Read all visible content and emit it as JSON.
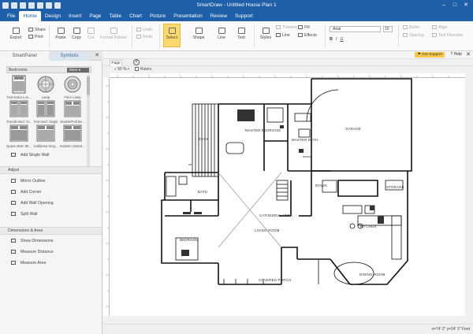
{
  "window": {
    "title": "SmartDraw - Untitled House Plan 1"
  },
  "menu": {
    "items": [
      "File",
      "Home",
      "Design",
      "Insert",
      "Page",
      "Table",
      "Chart",
      "Picture",
      "Presentation",
      "Review",
      "Support"
    ],
    "active": "Home"
  },
  "ribbon": {
    "export": "Export",
    "share": "Share",
    "print": "Print",
    "paste": "Paste",
    "copy": "Copy",
    "cut": "Cut",
    "format_painter": "Format Painter",
    "undo": "Undo",
    "redo": "Redo",
    "select": "Select",
    "shape": "Shape",
    "line": "Line",
    "text": "Text",
    "styles": "Styles",
    "themes": "Themes",
    "fill": "Fill",
    "line_small": "Line",
    "effects": "Effects",
    "font_name": "Arial",
    "font_size": "10",
    "bold": "B",
    "italic": "I",
    "underline": "U",
    "bullet": "Bullet",
    "spacing": "Spacing",
    "align": "Align",
    "text_direction": "Text Direction"
  },
  "left_panel": {
    "tab_smartpanel": "SmartPanel",
    "tab_symbols": "Symbols",
    "library_name": "Bedrooms",
    "more_label": "More",
    "symbols": [
      "Twin Extra Lon...",
      "Lamp",
      "Floor Lamp",
      "Trundle Bed: Si...",
      "Twin Bed: Single",
      "Double/Full Be...",
      "Queen Bed: 80...",
      "California King...",
      "Eastern (Stand..."
    ],
    "add_single_wall": "Add Single Wall",
    "adjust_header": "Adjust",
    "adjust_items": [
      "Mirror Outline",
      "Add Corner",
      "Add Wall Opening",
      "Split Wall"
    ],
    "dims_header": "Dimensions & Area",
    "dims_items": [
      "Show Dimensions",
      "Measure Distance",
      "Measure Area"
    ]
  },
  "top_strip": {
    "support": "Get Support",
    "help": "Help"
  },
  "page_tabs": {
    "tab": "Page 1",
    "add": "+"
  },
  "zoom": {
    "value": "55 %",
    "rulers": "Rulers"
  },
  "plan": {
    "labels": {
      "deck": "DECK",
      "master_bedroom": "MASTER BEDROOM",
      "master_bath": "MASTER BATH",
      "garage": "GARAGE",
      "bath": "BATH",
      "storage": "STORAGE",
      "cathedral": "CATHEDRAL AREA",
      "living": "LIVING ROOM",
      "kitchen": "KITCHEN",
      "bedroom": "BEDROOM",
      "covered_porch": "COVERED PORCH",
      "dining": "DINING ROOM",
      "down": "DOWN"
    }
  },
  "status": {
    "coords": "x=74' 2\"  y=24' 3\" Feet"
  }
}
